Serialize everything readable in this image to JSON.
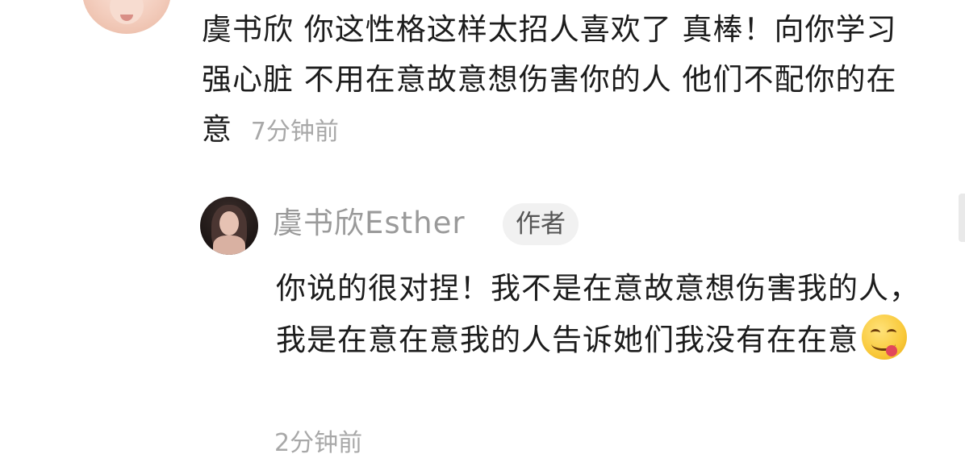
{
  "comment": {
    "author": "虞书欣",
    "text": "你这性格这样太招人喜欢了 真棒！向你学习强心脏 不用在意故意想伤害你的人 他们不配你的在意",
    "time": "7分钟前"
  },
  "reply": {
    "author": "虞书欣Esther",
    "badge": "作者",
    "text": "你说的很对捏！我不是在意故意想伤害我的人，我是在意在意我的人告诉她们我没有在在意",
    "emoji": "yum-face-icon",
    "time": "2分钟前"
  }
}
